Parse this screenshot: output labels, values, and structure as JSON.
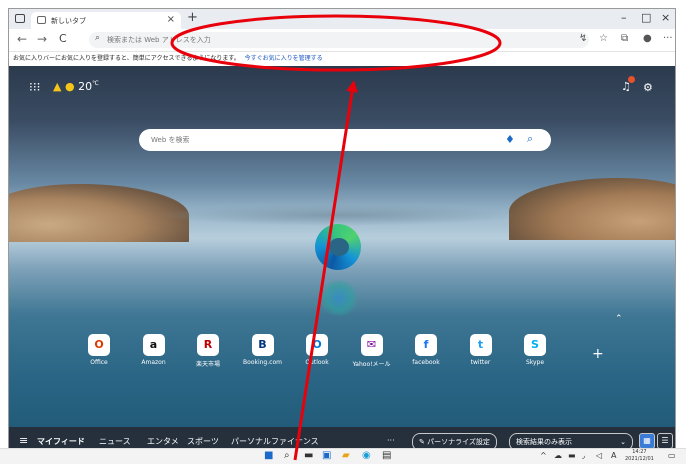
{
  "browser": {
    "tab_title": "新しいタブ",
    "tab_close": "×",
    "new_tab": "+",
    "window_controls": {
      "minimize": "–",
      "maximize": "□",
      "close": "×"
    },
    "nav": {
      "back": "←",
      "forward": "→",
      "refresh": "C"
    },
    "address_placeholder": "検索または Web アドレスを入力",
    "favorites_text": "お気に入りバーにお気に入りを登録すると、簡単にアクセスできるようになります。",
    "favorites_link": "今すぐお気に入りを管理する"
  },
  "newtab": {
    "weather_temp": "20",
    "weather_unit": "℃",
    "search_placeholder": "Web を検索",
    "quick_links": [
      {
        "label": "Office",
        "icon": "O",
        "color": "#d83b01"
      },
      {
        "label": "Amazon",
        "icon": "a",
        "color": "#111111"
      },
      {
        "label": "楽天市場",
        "icon": "R",
        "color": "#bf0000"
      },
      {
        "label": "Booking.com",
        "icon": "B",
        "color": "#003580"
      },
      {
        "label": "Outlook",
        "icon": "O",
        "color": "#0078d4"
      },
      {
        "label": "Yahoo!メール",
        "icon": "✉",
        "color": "#7b0099"
      },
      {
        "label": "facebook",
        "icon": "f",
        "color": "#1877f2"
      },
      {
        "label": "twitter",
        "icon": "t",
        "color": "#1da1f2"
      },
      {
        "label": "Skype",
        "icon": "S",
        "color": "#00aff0"
      }
    ],
    "feed": {
      "my_feed": "マイフィード",
      "news": "ニュース",
      "entertainment": "エンタメ",
      "sports": "スポーツ",
      "finance": "パーソナルファイナンス",
      "more": "···",
      "personalize": "パーソナライズ設定",
      "search_only": "検索結果のみ表示"
    }
  },
  "taskbar": {
    "ime": "A",
    "time": "14:27",
    "date": "2021/12/01"
  },
  "annotation": {
    "color": "#e8000b"
  }
}
